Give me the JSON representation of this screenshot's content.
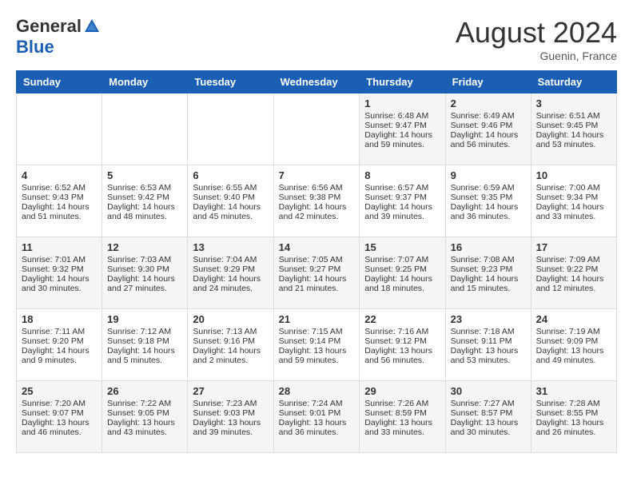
{
  "header": {
    "logo_general": "General",
    "logo_blue": "Blue",
    "month_year": "August 2024",
    "location": "Guenin, France"
  },
  "days_of_week": [
    "Sunday",
    "Monday",
    "Tuesday",
    "Wednesday",
    "Thursday",
    "Friday",
    "Saturday"
  ],
  "weeks": [
    [
      {
        "day": "",
        "sunrise": "",
        "sunset": "",
        "daylight": ""
      },
      {
        "day": "",
        "sunrise": "",
        "sunset": "",
        "daylight": ""
      },
      {
        "day": "",
        "sunrise": "",
        "sunset": "",
        "daylight": ""
      },
      {
        "day": "",
        "sunrise": "",
        "sunset": "",
        "daylight": ""
      },
      {
        "day": "1",
        "sunrise": "Sunrise: 6:48 AM",
        "sunset": "Sunset: 9:47 PM",
        "daylight": "Daylight: 14 hours and 59 minutes."
      },
      {
        "day": "2",
        "sunrise": "Sunrise: 6:49 AM",
        "sunset": "Sunset: 9:46 PM",
        "daylight": "Daylight: 14 hours and 56 minutes."
      },
      {
        "day": "3",
        "sunrise": "Sunrise: 6:51 AM",
        "sunset": "Sunset: 9:45 PM",
        "daylight": "Daylight: 14 hours and 53 minutes."
      }
    ],
    [
      {
        "day": "4",
        "sunrise": "Sunrise: 6:52 AM",
        "sunset": "Sunset: 9:43 PM",
        "daylight": "Daylight: 14 hours and 51 minutes."
      },
      {
        "day": "5",
        "sunrise": "Sunrise: 6:53 AM",
        "sunset": "Sunset: 9:42 PM",
        "daylight": "Daylight: 14 hours and 48 minutes."
      },
      {
        "day": "6",
        "sunrise": "Sunrise: 6:55 AM",
        "sunset": "Sunset: 9:40 PM",
        "daylight": "Daylight: 14 hours and 45 minutes."
      },
      {
        "day": "7",
        "sunrise": "Sunrise: 6:56 AM",
        "sunset": "Sunset: 9:38 PM",
        "daylight": "Daylight: 14 hours and 42 minutes."
      },
      {
        "day": "8",
        "sunrise": "Sunrise: 6:57 AM",
        "sunset": "Sunset: 9:37 PM",
        "daylight": "Daylight: 14 hours and 39 minutes."
      },
      {
        "day": "9",
        "sunrise": "Sunrise: 6:59 AM",
        "sunset": "Sunset: 9:35 PM",
        "daylight": "Daylight: 14 hours and 36 minutes."
      },
      {
        "day": "10",
        "sunrise": "Sunrise: 7:00 AM",
        "sunset": "Sunset: 9:34 PM",
        "daylight": "Daylight: 14 hours and 33 minutes."
      }
    ],
    [
      {
        "day": "11",
        "sunrise": "Sunrise: 7:01 AM",
        "sunset": "Sunset: 9:32 PM",
        "daylight": "Daylight: 14 hours and 30 minutes."
      },
      {
        "day": "12",
        "sunrise": "Sunrise: 7:03 AM",
        "sunset": "Sunset: 9:30 PM",
        "daylight": "Daylight: 14 hours and 27 minutes."
      },
      {
        "day": "13",
        "sunrise": "Sunrise: 7:04 AM",
        "sunset": "Sunset: 9:29 PM",
        "daylight": "Daylight: 14 hours and 24 minutes."
      },
      {
        "day": "14",
        "sunrise": "Sunrise: 7:05 AM",
        "sunset": "Sunset: 9:27 PM",
        "daylight": "Daylight: 14 hours and 21 minutes."
      },
      {
        "day": "15",
        "sunrise": "Sunrise: 7:07 AM",
        "sunset": "Sunset: 9:25 PM",
        "daylight": "Daylight: 14 hours and 18 minutes."
      },
      {
        "day": "16",
        "sunrise": "Sunrise: 7:08 AM",
        "sunset": "Sunset: 9:23 PM",
        "daylight": "Daylight: 14 hours and 15 minutes."
      },
      {
        "day": "17",
        "sunrise": "Sunrise: 7:09 AM",
        "sunset": "Sunset: 9:22 PM",
        "daylight": "Daylight: 14 hours and 12 minutes."
      }
    ],
    [
      {
        "day": "18",
        "sunrise": "Sunrise: 7:11 AM",
        "sunset": "Sunset: 9:20 PM",
        "daylight": "Daylight: 14 hours and 9 minutes."
      },
      {
        "day": "19",
        "sunrise": "Sunrise: 7:12 AM",
        "sunset": "Sunset: 9:18 PM",
        "daylight": "Daylight: 14 hours and 5 minutes."
      },
      {
        "day": "20",
        "sunrise": "Sunrise: 7:13 AM",
        "sunset": "Sunset: 9:16 PM",
        "daylight": "Daylight: 14 hours and 2 minutes."
      },
      {
        "day": "21",
        "sunrise": "Sunrise: 7:15 AM",
        "sunset": "Sunset: 9:14 PM",
        "daylight": "Daylight: 13 hours and 59 minutes."
      },
      {
        "day": "22",
        "sunrise": "Sunrise: 7:16 AM",
        "sunset": "Sunset: 9:12 PM",
        "daylight": "Daylight: 13 hours and 56 minutes."
      },
      {
        "day": "23",
        "sunrise": "Sunrise: 7:18 AM",
        "sunset": "Sunset: 9:11 PM",
        "daylight": "Daylight: 13 hours and 53 minutes."
      },
      {
        "day": "24",
        "sunrise": "Sunrise: 7:19 AM",
        "sunset": "Sunset: 9:09 PM",
        "daylight": "Daylight: 13 hours and 49 minutes."
      }
    ],
    [
      {
        "day": "25",
        "sunrise": "Sunrise: 7:20 AM",
        "sunset": "Sunset: 9:07 PM",
        "daylight": "Daylight: 13 hours and 46 minutes."
      },
      {
        "day": "26",
        "sunrise": "Sunrise: 7:22 AM",
        "sunset": "Sunset: 9:05 PM",
        "daylight": "Daylight: 13 hours and 43 minutes."
      },
      {
        "day": "27",
        "sunrise": "Sunrise: 7:23 AM",
        "sunset": "Sunset: 9:03 PM",
        "daylight": "Daylight: 13 hours and 39 minutes."
      },
      {
        "day": "28",
        "sunrise": "Sunrise: 7:24 AM",
        "sunset": "Sunset: 9:01 PM",
        "daylight": "Daylight: 13 hours and 36 minutes."
      },
      {
        "day": "29",
        "sunrise": "Sunrise: 7:26 AM",
        "sunset": "Sunset: 8:59 PM",
        "daylight": "Daylight: 13 hours and 33 minutes."
      },
      {
        "day": "30",
        "sunrise": "Sunrise: 7:27 AM",
        "sunset": "Sunset: 8:57 PM",
        "daylight": "Daylight: 13 hours and 30 minutes."
      },
      {
        "day": "31",
        "sunrise": "Sunrise: 7:28 AM",
        "sunset": "Sunset: 8:55 PM",
        "daylight": "Daylight: 13 hours and 26 minutes."
      }
    ]
  ]
}
